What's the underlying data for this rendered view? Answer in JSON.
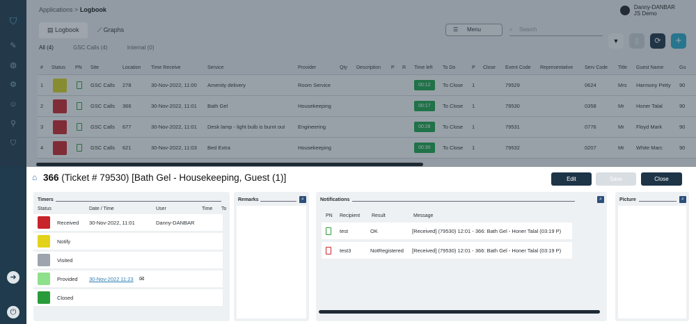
{
  "breadcrumb": {
    "parent": "Applications",
    "sep": ">",
    "current": "Logbook"
  },
  "user": {
    "name": "Danny-DANBAR",
    "org": "JS Demo"
  },
  "tabs": [
    {
      "label": "Logbook"
    },
    {
      "label": "Graphs"
    }
  ],
  "toolbar": {
    "menu_label": "Menu",
    "search_placeholder": "Search"
  },
  "subtabs": [
    "All (4)",
    "GSC Calls (4)",
    "Internal (0)"
  ],
  "columns": [
    "#",
    "Status",
    "PN",
    "Site",
    "Location",
    "Time Receive",
    "Service",
    "Provider",
    "Qty",
    "Description",
    "P",
    "R",
    "Time left",
    "To Do",
    "P",
    "Close",
    "Event Code",
    "Representative",
    "Serv Code",
    "Title",
    "Guest Name",
    "Gu"
  ],
  "rows": [
    {
      "n": "1",
      "color": "#d8d11f",
      "site": "GSC Calls",
      "location": "278",
      "time": "30-Nov-2022, 11:00",
      "service": "Amenity delivery",
      "provider": "Room Service",
      "left": "00:12",
      "todo": "To Close",
      "p": "1",
      "event": "79529",
      "serv": "0624",
      "title": "Mrs",
      "guest": "Harmony Petty",
      "gu": "90"
    },
    {
      "n": "2",
      "color": "#c8242b",
      "site": "GSC Calls",
      "location": "366",
      "time": "30-Nov-2022, 11:01",
      "service": "Bath Gel",
      "provider": "Housekeeping",
      "left": "00:17",
      "todo": "To Close",
      "p": "1",
      "event": "79530",
      "serv": "0358",
      "title": "Mr",
      "guest": "Honer Talal",
      "gu": "90"
    },
    {
      "n": "3",
      "color": "#c8242b",
      "site": "GSC Calls",
      "location": "677",
      "time": "30-Nov-2022, 11:01",
      "service": "Desk lamp - light bulb is burnt out",
      "provider": "Engineering",
      "left": "00:28",
      "todo": "To Close",
      "p": "1",
      "event": "79531",
      "serv": "0776",
      "title": "Mr",
      "guest": "Floyd Mark",
      "gu": "90"
    },
    {
      "n": "4",
      "color": "#c8242b",
      "site": "GSC Calls",
      "location": "621",
      "time": "30-Nov-2022, 11:03",
      "service": "Bed Extra",
      "provider": "Housekeeping",
      "left": "00:30",
      "todo": "To Close",
      "p": "1",
      "event": "79532",
      "serv": "0207",
      "title": "Mr",
      "guest": "White Marc",
      "gu": "90"
    }
  ],
  "detail": {
    "title_bold": "366",
    "title_rest": "(Ticket # 79530) [Bath Gel - Housekeeping, Guest (1)]",
    "edit_label": "Edit",
    "save_label": "Save",
    "close_label": "Close"
  },
  "timers": {
    "title": "Timers",
    "cols": [
      "Status",
      "Date / Time",
      "User",
      "Time",
      "To"
    ],
    "rows": [
      {
        "color": "#c8242b",
        "label": "Received",
        "date": "30-Nov-2022, 11:01",
        "user": "Danny-DANBAR"
      },
      {
        "color": "#e3d21c",
        "label": "Notify",
        "date": "",
        "user": ""
      },
      {
        "color": "#9ea4ad",
        "label": "Visited",
        "date": "",
        "user": ""
      },
      {
        "color": "#8fe08a",
        "label": "Provided",
        "date": "30-Nov-2022 11:23",
        "user": ""
      },
      {
        "color": "#2a9b3a",
        "label": "Closed",
        "date": "",
        "user": ""
      }
    ]
  },
  "remarks": {
    "title": "Remarks"
  },
  "notifications": {
    "title": "Notifications",
    "cols": [
      "PN",
      "Recipient",
      "Result",
      "Message"
    ],
    "rows": [
      {
        "pn_color": "#2a9b3a",
        "recipient": "test",
        "result": "OK",
        "message": "[Received] (79530) 12:01 - 366: Bath Gel - Honer Talal (03:19 P)"
      },
      {
        "pn_color": "#c8242b",
        "recipient": "test3",
        "result": "NotRegistered",
        "message": "[Received] (79530) 12:01 - 366: Bath Gel - Honer Talal (03:19 P)"
      }
    ]
  },
  "picture": {
    "title": "Picture"
  },
  "colors": {
    "sidebar": "#1f3b4d",
    "dark_button": "#1e3447",
    "accent_teal": "#27a9c9",
    "timer_green": "#1aa34a"
  }
}
